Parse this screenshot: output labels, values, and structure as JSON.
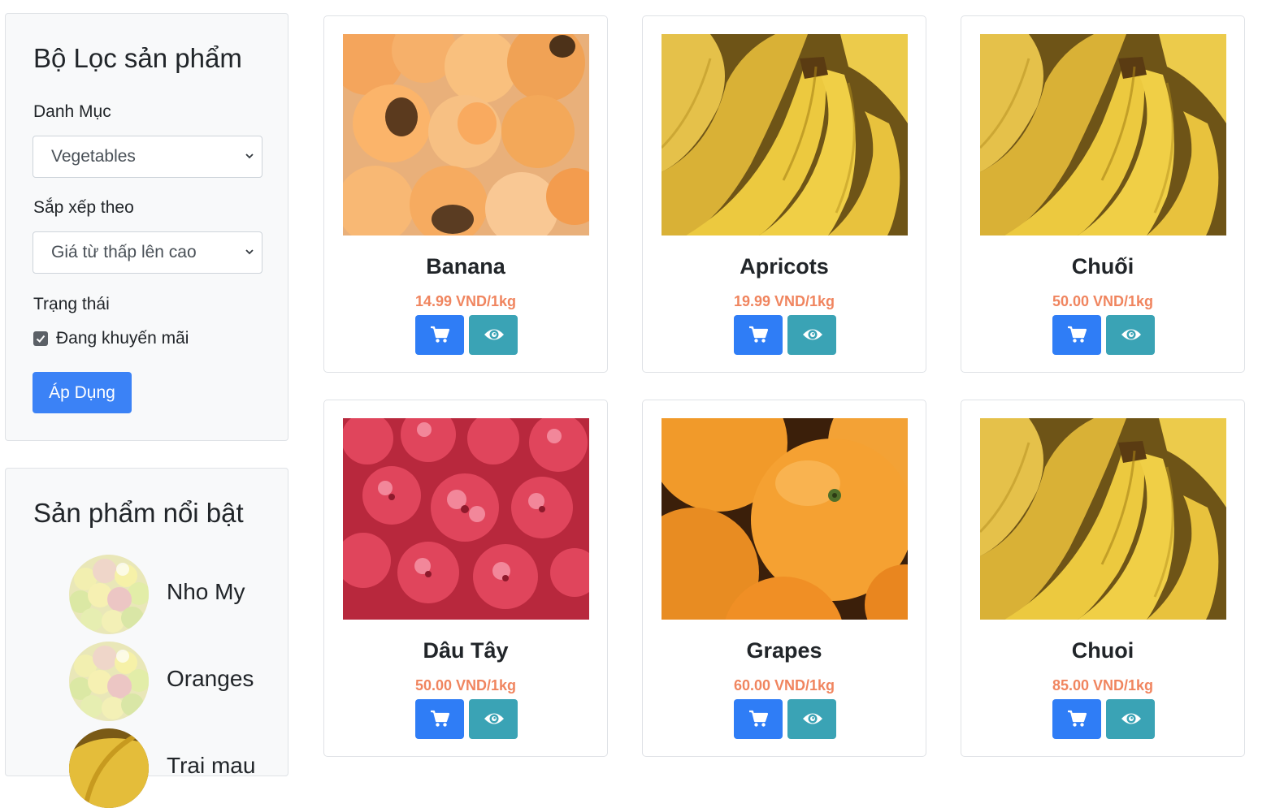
{
  "filter": {
    "title": "Bộ Lọc sản phẩm",
    "category_label": "Danh Mục",
    "category_value": "Vegetables",
    "sort_label": "Sắp xếp theo",
    "sort_value": "Giá từ thấp lên cao",
    "status_label": "Trạng thái",
    "promo_label": "Đang khuyến mãi",
    "promo_checked": true,
    "apply_label": "Áp Dụng"
  },
  "featured": {
    "title": "Sản phẩm nổi bật",
    "items": [
      {
        "name": "Nho My",
        "image": "grapes"
      },
      {
        "name": "Oranges",
        "image": "grapes"
      },
      {
        "name": "Trai mau",
        "image": "banana"
      }
    ]
  },
  "products": [
    {
      "name": "Banana",
      "price": "14.99 VND/1kg",
      "image": "apricots"
    },
    {
      "name": "Apricots",
      "price": "19.99 VND/1kg",
      "image": "banana"
    },
    {
      "name": "Chuối",
      "price": "50.00 VND/1kg",
      "image": "banana"
    },
    {
      "name": "Dâu Tây",
      "price": "50.00 VND/1kg",
      "image": "raspberries"
    },
    {
      "name": "Grapes",
      "price": "60.00 VND/1kg",
      "image": "oranges"
    },
    {
      "name": "Chuoi",
      "price": "85.00 VND/1kg",
      "image": "banana"
    }
  ],
  "icons": {
    "cart": "cart-icon",
    "view": "eye-icon",
    "select": "chevron-down-icon",
    "check": "check-icon"
  },
  "colors": {
    "primary": "#2f7df6",
    "info": "#3aa3b5",
    "price": "#f0855f"
  }
}
